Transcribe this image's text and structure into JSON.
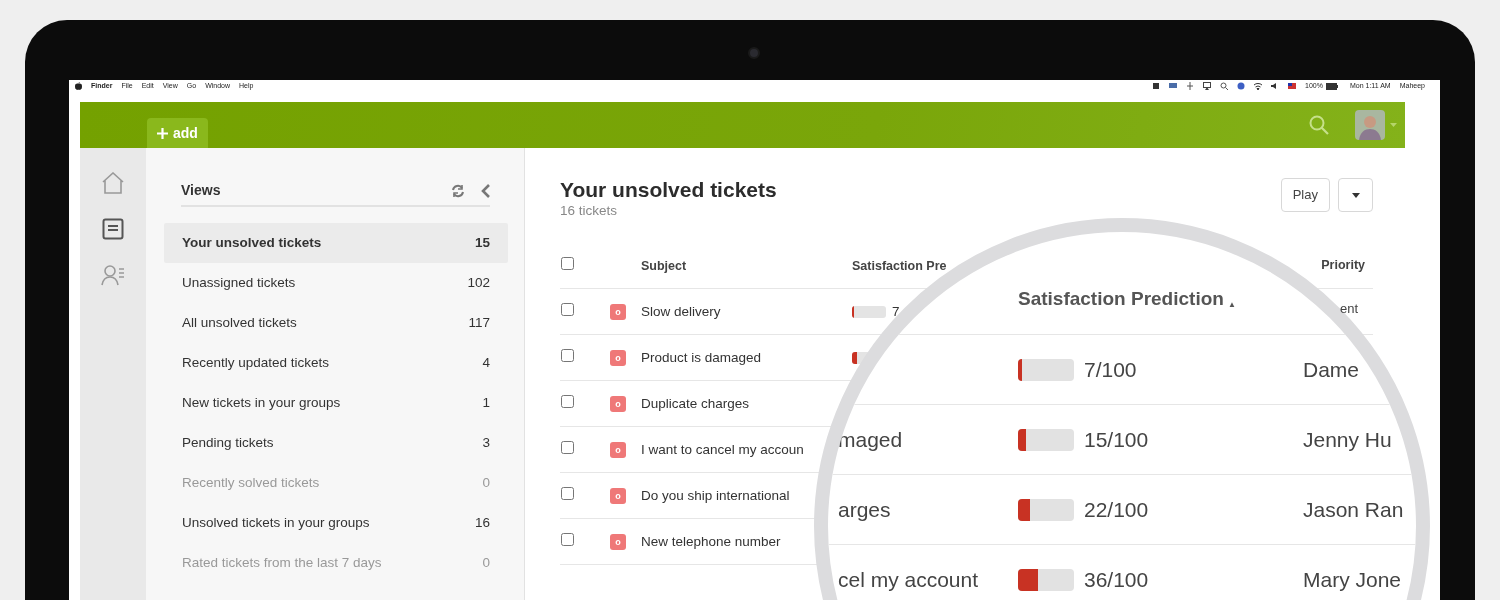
{
  "menubar": {
    "app": "Finder",
    "menus": [
      "File",
      "Edit",
      "View",
      "Go",
      "Window",
      "Help"
    ],
    "battery": "100%",
    "clock": "Mon 1:11 AM",
    "user": "Maheep"
  },
  "header": {
    "add_label": "add"
  },
  "views": {
    "title": "Views",
    "items": [
      {
        "label": "Your unsolved tickets",
        "count": "15",
        "selected": true,
        "muted": false
      },
      {
        "label": "Unassigned tickets",
        "count": "102",
        "selected": false,
        "muted": false
      },
      {
        "label": "All unsolved tickets",
        "count": "117",
        "selected": false,
        "muted": false
      },
      {
        "label": "Recently updated tickets",
        "count": "4",
        "selected": false,
        "muted": false
      },
      {
        "label": "New tickets in your groups",
        "count": "1",
        "selected": false,
        "muted": false
      },
      {
        "label": "Pending tickets",
        "count": "3",
        "selected": false,
        "muted": false
      },
      {
        "label": "Recently solved tickets",
        "count": "0",
        "selected": false,
        "muted": true
      },
      {
        "label": "Unsolved tickets in your groups",
        "count": "16",
        "selected": false,
        "muted": false
      },
      {
        "label": "Rated tickets from the last 7 days",
        "count": "0",
        "selected": false,
        "muted": true
      }
    ]
  },
  "main": {
    "title": "Your unsolved tickets",
    "subtitle": "16 tickets",
    "play_label": "Play"
  },
  "table": {
    "select_all_checked": false,
    "columns": [
      "Subject",
      "Satisfaction Pre",
      "Priority"
    ],
    "rows": [
      {
        "checked": false,
        "status": "o",
        "subject": "Slow delivery",
        "satisfaction": {
          "level": 0.07,
          "reading": "7"
        }
      },
      {
        "checked": false,
        "status": "o",
        "subject": "Product is damaged",
        "satisfaction": {
          "level": 0.15
        }
      },
      {
        "checked": false,
        "status": "o",
        "subject": "Duplicate charges"
      },
      {
        "checked": false,
        "status": "o",
        "subject": "I want to cancel my accoun"
      },
      {
        "checked": false,
        "status": "o",
        "subject": "Do you ship international"
      },
      {
        "checked": false,
        "status": "o",
        "subject": "New telephone number"
      }
    ]
  },
  "magnifier": {
    "header": "Satisfaction Prediction",
    "sort_arrow": "▲",
    "priority_fragment": "ent",
    "rows": [
      {
        "level": 0.07,
        "reading": "7/100",
        "assignee": "Dame"
      },
      {
        "subject": "maged",
        "level": 0.15,
        "reading": "15/100",
        "assignee": "Jenny Hu"
      },
      {
        "subject": "arges",
        "level": 0.22,
        "reading": "22/100",
        "assignee": "Jason Ran"
      },
      {
        "subject": "cel my account",
        "level": 0.36,
        "reading": "36/100",
        "assignee": "Mary Jone"
      }
    ]
  }
}
